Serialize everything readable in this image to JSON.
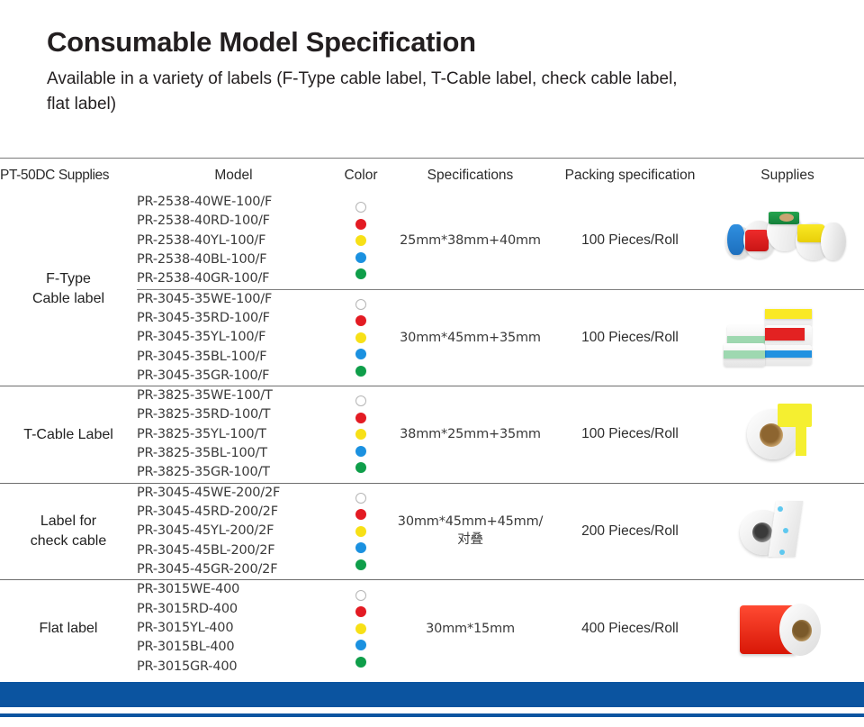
{
  "header": {
    "title": "Consumable Model Specification",
    "subtitle": "Available in a variety of labels (F-Type cable label, T-Cable label, check cable label, flat label)"
  },
  "theme": {
    "accent_blue": "#0b54a0",
    "border_gray": "#6e6e6e",
    "text_dark": "#231f20"
  },
  "table": {
    "columns": [
      {
        "key": "type",
        "label": "PT-50DC Supplies"
      },
      {
        "key": "model",
        "label": "Model"
      },
      {
        "key": "color",
        "label": "Color"
      },
      {
        "key": "spec",
        "label": "Specifications"
      },
      {
        "key": "pack",
        "label": "Packing specification"
      },
      {
        "key": "supp",
        "label": "Supplies"
      }
    ],
    "color_swatches": [
      {
        "name": "white",
        "hex": "#ffffff"
      },
      {
        "name": "red",
        "hex": "#e31b23"
      },
      {
        "name": "yellow",
        "hex": "#f7e017"
      },
      {
        "name": "blue",
        "hex": "#1b91e0"
      },
      {
        "name": "green",
        "hex": "#0f9e4a"
      }
    ],
    "groups": [
      {
        "type": "F-Type\nCable label",
        "type_lines": [
          "F-Type",
          "Cable label"
        ],
        "rows": [
          {
            "models": [
              "PR-2538-40WE-100/F",
              "PR-2538-40RD-100/F",
              "PR-2538-40YL-100/F",
              "PR-2538-40BL-100/F",
              "PR-2538-40GR-100/F"
            ],
            "spec": "25mm*38mm+40mm",
            "pack": "100 Pieces/Roll",
            "supply_image": "multi-color-label-roll-cluster"
          },
          {
            "models": [
              "PR-3045-35WE-100/F",
              "PR-3045-35RD-100/F",
              "PR-3045-35YL-100/F",
              "PR-3045-35BL-100/F",
              "PR-3045-35GR-100/F"
            ],
            "spec": "30mm*45mm+35mm",
            "pack": "100 Pieces/Roll",
            "supply_image": "stacked-color-label-rolls"
          }
        ]
      },
      {
        "type": "T-Cable Label",
        "type_lines": [
          "T-Cable Label"
        ],
        "rows": [
          {
            "models": [
              "PR-3825-35WE-100/T",
              "PR-3825-35RD-100/T",
              "PR-3825-35YL-100/T",
              "PR-3825-35BL-100/T",
              "PR-3825-35GR-100/T"
            ],
            "spec": "38mm*25mm+35mm",
            "pack": "100 Pieces/Roll",
            "supply_image": "yellow-t-label-roll"
          }
        ]
      },
      {
        "type": "Label for\ncheck cable",
        "type_lines": [
          "Label for",
          "check cable"
        ],
        "rows": [
          {
            "models": [
              "PR-3045-45WE-200/2F",
              "PR-3045-45RD-200/2F",
              "PR-3045-45YL-200/2F",
              "PR-3045-45BL-200/2F",
              "PR-3045-45GR-200/2F"
            ],
            "spec": "30mm*45mm+45mm/对叠",
            "pack": "200 Pieces/Roll",
            "supply_image": "white-flag-label-roll"
          }
        ]
      },
      {
        "type": "Flat label",
        "type_lines": [
          "Flat label"
        ],
        "rows": [
          {
            "models": [
              "PR-3015WE-400",
              "PR-3015RD-400",
              "PR-3015YL-400",
              "PR-3015BL-400",
              "PR-3015GR-400"
            ],
            "spec": "30mm*15mm",
            "pack": "400 Pieces/Roll",
            "supply_image": "red-flat-label-roll"
          }
        ]
      }
    ]
  }
}
